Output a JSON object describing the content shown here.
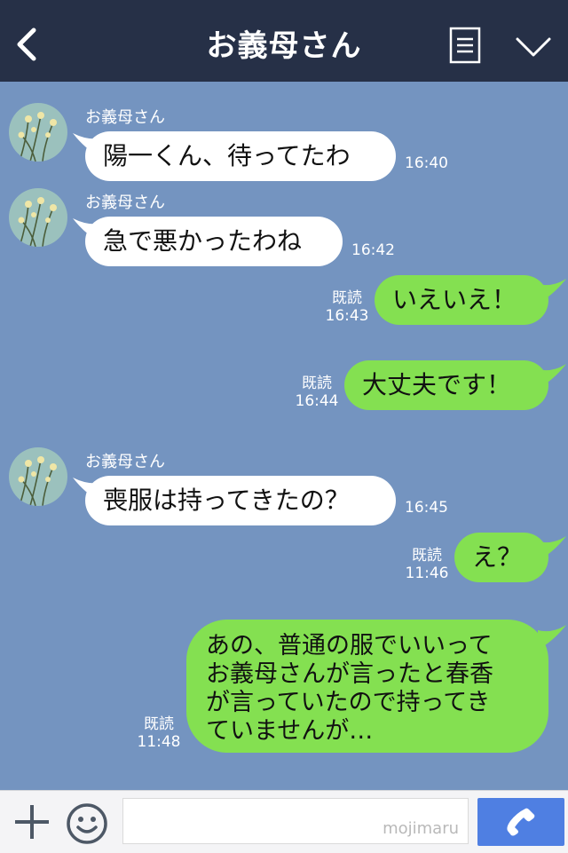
{
  "header": {
    "title": "お義母さん",
    "back_icon": "chevron-left-icon",
    "menu_icon": "note-icon",
    "collapse_icon": "chevron-down-icon",
    "background": "#263047"
  },
  "chat": {
    "background": "#7494c0",
    "messages": [
      {
        "direction": "in",
        "sender": "お義母さん",
        "text": "陽一くん、待ってたわ",
        "time": "16:40"
      },
      {
        "direction": "in",
        "sender": "お義母さん",
        "text": "急で悪かったわね",
        "time": "16:42"
      },
      {
        "direction": "out",
        "read": "既読",
        "text": "いえいえ！",
        "time": "16:43"
      },
      {
        "direction": "out",
        "read": "既読",
        "text": "大丈夫です！",
        "time": "16:44"
      },
      {
        "direction": "in",
        "sender": "お義母さん",
        "text": "喪服は持ってきたの？",
        "time": "16:45"
      },
      {
        "direction": "out",
        "read": "既読",
        "text": "え？",
        "time": "11:46"
      },
      {
        "direction": "out",
        "read": "既読",
        "lines": [
          "あの、普通の服でいいって",
          "お義母さんが言ったと春香",
          "が言っていたので持ってき",
          "ていませんが…"
        ],
        "time": "11:48"
      }
    ]
  },
  "footer": {
    "plus_icon": "plus-icon",
    "emoji_icon": "smiley-icon",
    "input_value": "",
    "watermark": "mojimaru",
    "call_icon": "phone-icon",
    "accent": "#4f7fe2"
  },
  "colors": {
    "incoming_bubble": "#ffffff",
    "outgoing_bubble": "#84e051"
  }
}
